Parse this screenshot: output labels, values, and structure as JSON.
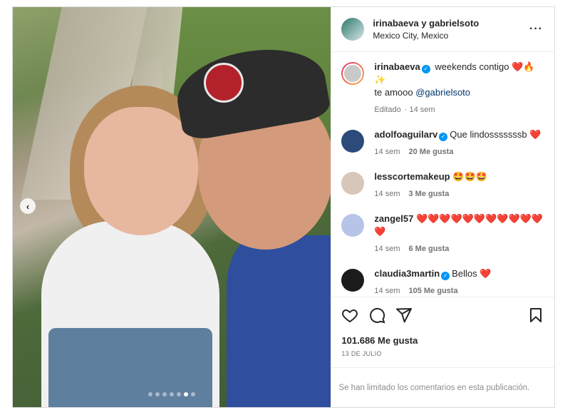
{
  "post": {
    "header": {
      "title": "irinabaeva y gabrielsoto",
      "location": "Mexico City, Mexico",
      "more_icon": "more-horizontal-icon"
    },
    "carousel": {
      "total": 7,
      "active_index": 5
    },
    "caption": {
      "user": "irinabaeva",
      "text": "weekends contigo",
      "emojis": "❤️🔥✨",
      "line2_prefix": "te amooo ",
      "mention": "@gabrielsoto",
      "edited": "Editado",
      "time": "14 sem"
    },
    "comments": [
      {
        "user": "adolfoaguilarv",
        "verified": true,
        "text": "Que lindosssssssb",
        "emoji": "❤️",
        "time": "14 sem",
        "likes": "20 Me gusta",
        "avatar_color": "#2c4a7a"
      },
      {
        "user": "lesscortemakeup",
        "verified": false,
        "text": "",
        "emoji": "🤩🤩🤩",
        "time": "14 sem",
        "likes": "3 Me gusta",
        "avatar_color": "#d8c6b8"
      },
      {
        "user": "zangel57",
        "verified": false,
        "text": "",
        "emoji": "❤️❤️❤️❤️❤️❤️❤️❤️❤️❤️❤️❤️",
        "time": "14 sem",
        "likes": "6 Me gusta",
        "avatar_color": "#b7c4e8"
      },
      {
        "user": "claudia3martin",
        "verified": true,
        "text": "Bellos",
        "emoji": "❤️",
        "time": "14 sem",
        "likes": "105 Me gusta",
        "avatar_color": "#1b1b1b"
      }
    ],
    "like_count": "101.686 Me gusta",
    "date": "13 DE JULIO",
    "comments_limited": "Se han limitado los comentarios en esta publicación."
  }
}
